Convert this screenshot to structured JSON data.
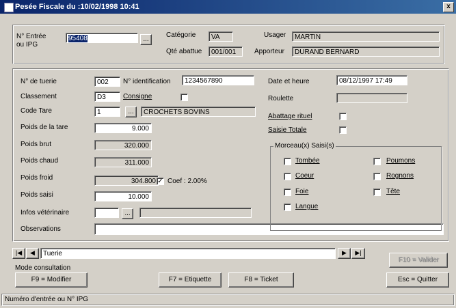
{
  "window": {
    "title": "Pesée Fiscale du :10/02/1998 10:41",
    "close": "x"
  },
  "top": {
    "entree_label_1": "N° Entrée",
    "entree_label_2": "ou IPG",
    "entree_value": "95408",
    "categorie_label": "Catégorie",
    "categorie_value": "VA",
    "usager_label": "Usager",
    "usager_value": "MARTIN",
    "qte_label": "Qté abattue",
    "qte_value": "001/001",
    "apporteur_label": "Apporteur",
    "apporteur_value": "DURAND BERNARD"
  },
  "form": {
    "tuerie_label": "N° de tuerie",
    "tuerie_value": "002",
    "ident_label": "N° identification",
    "ident_value": "1234567890",
    "classement_label": "Classement",
    "classement_value": "D3",
    "consigne_label": "Consigne",
    "code_tare_label": "Code Tare",
    "code_tare_value": "1",
    "code_tare_desc": "CROCHETS BOVINS",
    "poids_tare_label": "Poids de la tare",
    "poids_tare_value": "9.000",
    "poids_brut_label": "Poids brut",
    "poids_brut_value": "320.000",
    "poids_chaud_label": "Poids chaud",
    "poids_chaud_value": "311.000",
    "poids_froid_label": "Poids froid",
    "poids_froid_value": "304.800",
    "coef_label": "Coef : 2.00%",
    "coef_mark": "✓",
    "poids_saisi_label": "Poids saisi",
    "poids_saisi_value": "10.000",
    "infos_vet_label": "Infos vétérinaire",
    "observations_label": "Observations",
    "date_label": "Date et heure",
    "date_value": "08/12/1997 17:49",
    "roulette_label": "Roulette",
    "abattage_label": "Abattage rituel",
    "saisie_totale_label": "Saisie Totale"
  },
  "morceaux": {
    "title": "Morceau(x) Saisi(s)",
    "left": [
      "Tombée",
      "Coeur",
      "Foie",
      "Langue"
    ],
    "right": [
      "Poumons",
      "Rognons",
      "Tête"
    ]
  },
  "nav": {
    "first": "|◀",
    "prev": "◀",
    "record": "Tuerie",
    "next": "▶",
    "last": "▶|"
  },
  "buttons": {
    "f10": "F10 = Valider",
    "mode": "Mode consultation",
    "f9": "F9 = Modifier",
    "f7": "F7 = Etiquette",
    "f8": "F8 = Ticket",
    "esc": "Esc = Quitter"
  },
  "status": "Numéro d'entrée ou N° IPG"
}
